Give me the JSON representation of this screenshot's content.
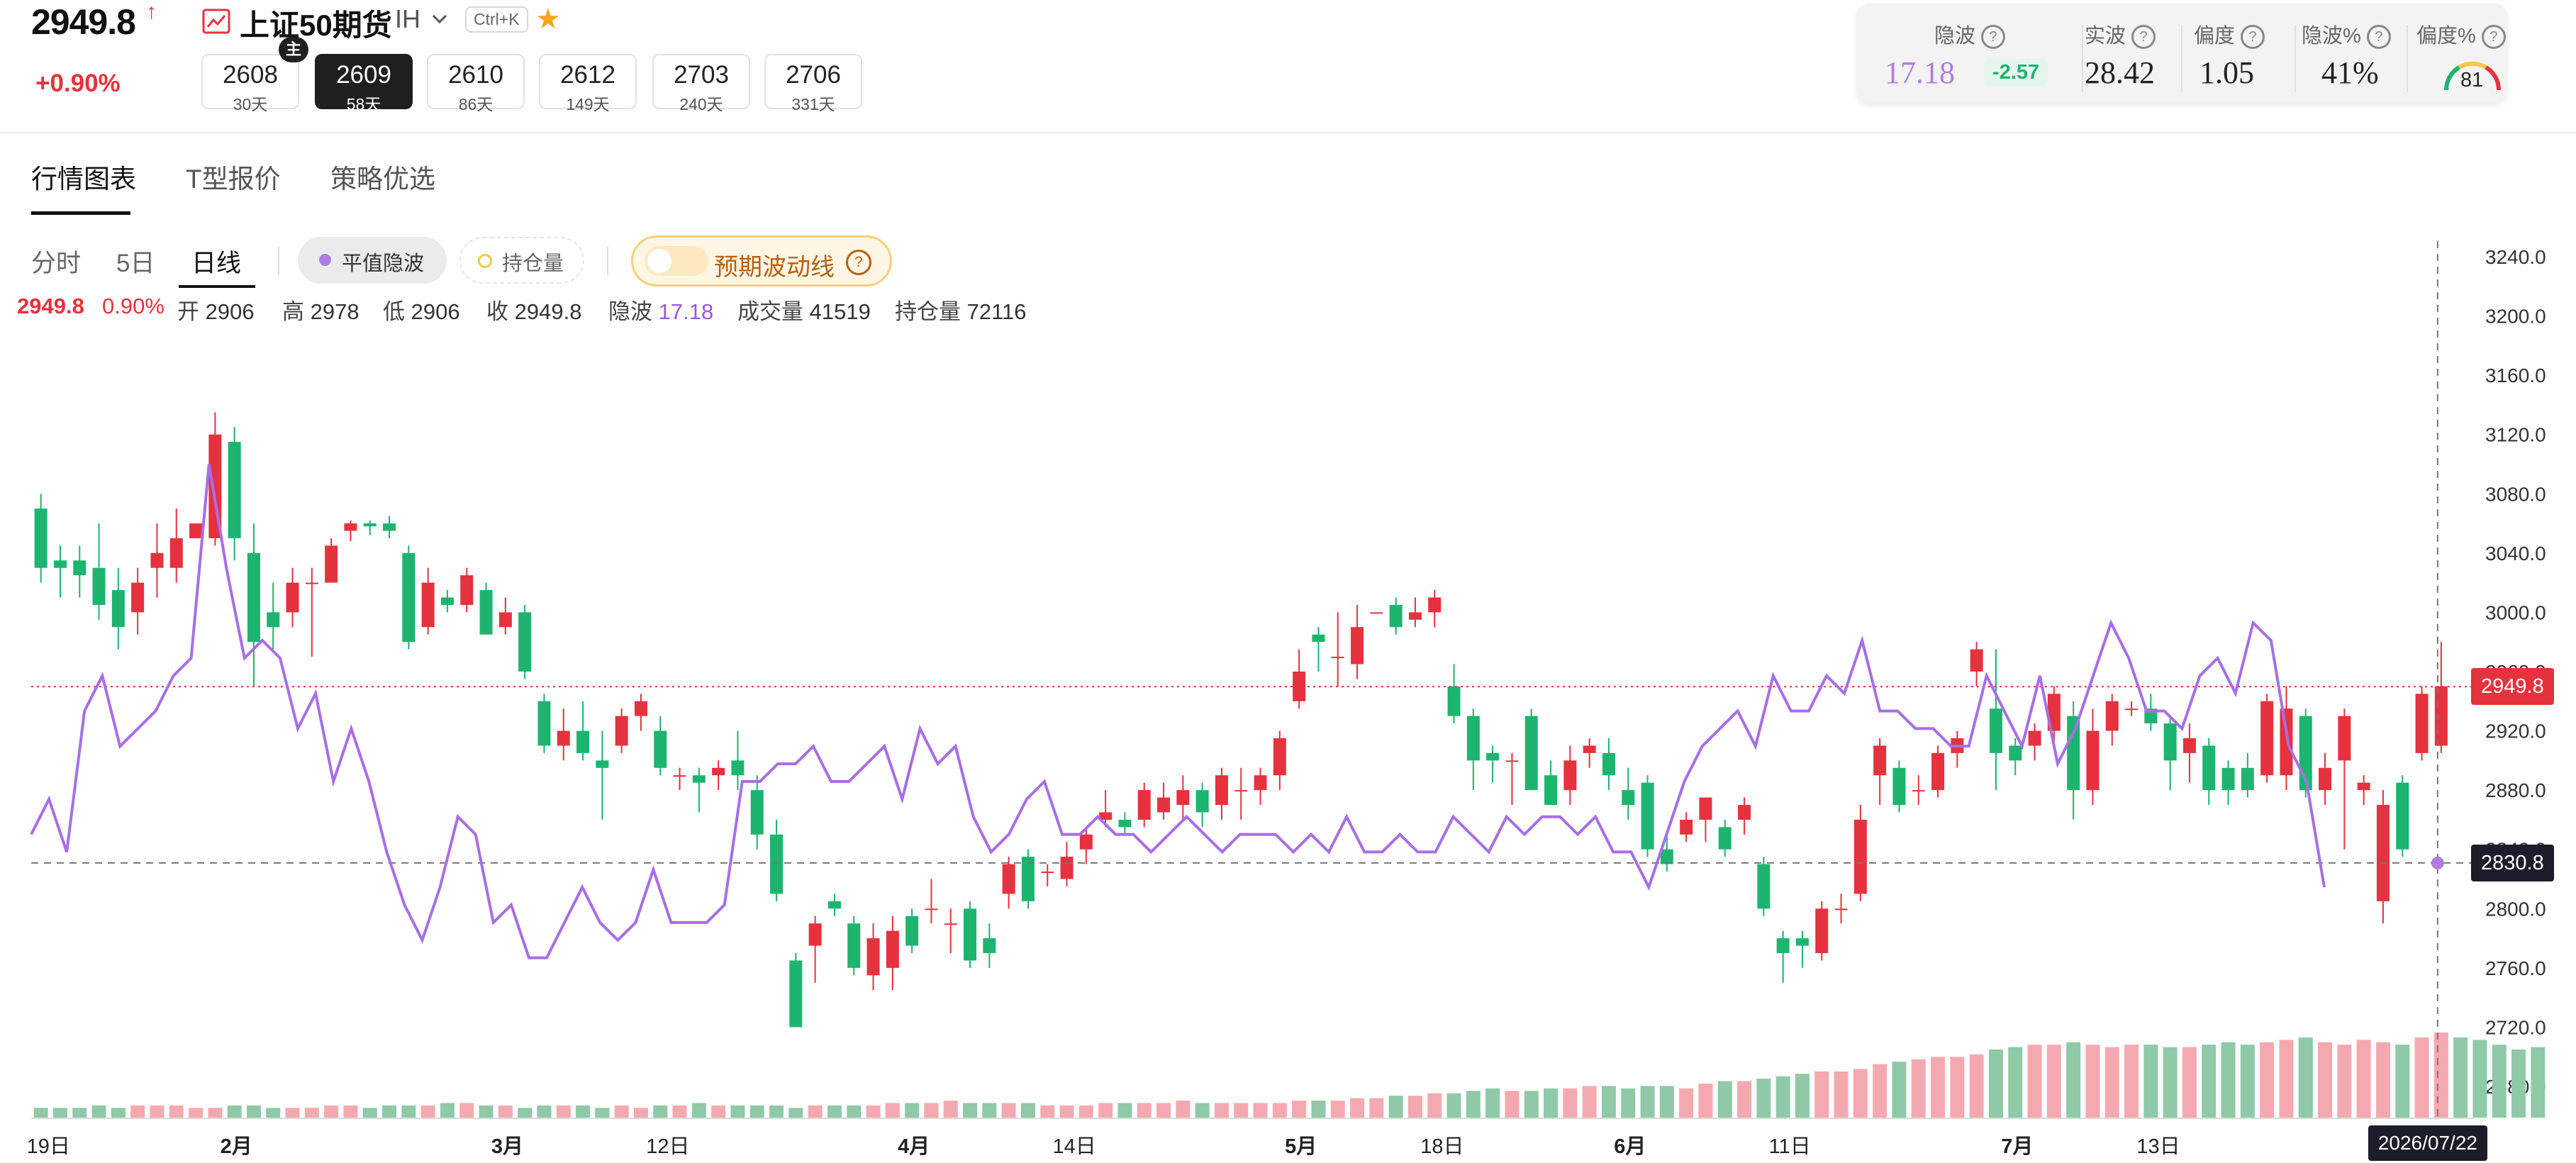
{
  "header": {
    "price": "2949.8",
    "price_arrow": "↑",
    "change_pct": "+0.90%",
    "title": "上证50期货",
    "code": "IH",
    "shortcut": "Ctrl+K",
    "main_badge": "主",
    "colors": {
      "up": "#e5323e",
      "down": "#1db470",
      "accent": "#f5a623"
    }
  },
  "contracts": [
    {
      "code": "2608",
      "days": "30天",
      "active": false
    },
    {
      "code": "2609",
      "days": "58天",
      "active": true
    },
    {
      "code": "2610",
      "days": "86天",
      "active": false
    },
    {
      "code": "2612",
      "days": "149天",
      "active": false
    },
    {
      "code": "2703",
      "days": "240天",
      "active": false
    },
    {
      "code": "2706",
      "days": "331天",
      "active": false
    }
  ],
  "stats": {
    "iv_label": "隐波",
    "iv_value": "17.18",
    "iv_change": "-2.57",
    "rv_label": "实波",
    "rv_value": "28.42",
    "skew_label": "偏度",
    "skew_value": "1.05",
    "iv_pct_label": "隐波%",
    "iv_pct_value": "41%",
    "skew_pct_label": "偏度%",
    "skew_pct_value": "81",
    "help_glyph": "?"
  },
  "main_tabs": [
    "行情图表",
    "T型报价",
    "策略优选"
  ],
  "period_tabs": [
    "分时",
    "5日",
    "日线"
  ],
  "toggles": {
    "flat_iv": "平值隐波",
    "open_interest": "持仓量",
    "expected_vol": "预期波动线",
    "help": "?"
  },
  "info": {
    "price": "2949.8",
    "pct": "0.90%",
    "open_label": "开",
    "open": "2906",
    "high_label": "高",
    "high": "2978",
    "low_label": "低",
    "low": "2906",
    "close_label": "收",
    "close": "2949.8",
    "iv_label": "隐波",
    "iv": "17.18",
    "vol_label": "成交量",
    "vol": "41519",
    "oi_label": "持仓量",
    "oi": "72116"
  },
  "chart_data": {
    "type": "candlestick",
    "y_axis": {
      "min": 2660,
      "max": 3260,
      "ticks": [
        "2680.0",
        "2720.0",
        "2760.0",
        "2800.0",
        "2840.0",
        "2880.0",
        "2920.0",
        "2960.0",
        "3000.0",
        "3040.0",
        "3080.0",
        "3120.0",
        "3160.0",
        "3200.0",
        "3240.0"
      ]
    },
    "x_labels": [
      {
        "i": 0,
        "t": "19日"
      },
      {
        "i": 10,
        "t": "2月"
      },
      {
        "i": 24,
        "t": "3月"
      },
      {
        "i": 32,
        "t": "12日"
      },
      {
        "i": 45,
        "t": "4月"
      },
      {
        "i": 53,
        "t": "14日"
      },
      {
        "i": 65,
        "t": "5月"
      },
      {
        "i": 72,
        "t": "18日"
      },
      {
        "i": 82,
        "t": "6月"
      },
      {
        "i": 90,
        "t": "11日"
      },
      {
        "i": 102,
        "t": "7月"
      },
      {
        "i": 109,
        "t": "13日"
      }
    ],
    "cursor_date": "2026/07/22",
    "current_price_label": "2949.8",
    "cursor_price_label": "2830.8",
    "current_price": 2949.8,
    "cursor_price": 2830.8,
    "candles": [
      [
        3070,
        3030,
        3080,
        3020
      ],
      [
        3035,
        3030,
        3045,
        3010
      ],
      [
        3035,
        3025,
        3045,
        3010
      ],
      [
        3030,
        3005,
        3060,
        2995
      ],
      [
        3015,
        2990,
        3030,
        2975
      ],
      [
        3000,
        3020,
        3030,
        2985
      ],
      [
        3030,
        3040,
        3060,
        3010
      ],
      [
        3030,
        3050,
        3070,
        3020
      ],
      [
        3050,
        3060,
        3060,
        3050
      ],
      [
        3050,
        3120,
        3135,
        3045
      ],
      [
        3115,
        3050,
        3125,
        3035
      ],
      [
        3040,
        2980,
        3060,
        2950
      ],
      [
        3000,
        2990,
        3020,
        2975
      ],
      [
        3000,
        3020,
        3030,
        2990
      ],
      [
        3020,
        3020,
        3030,
        2970
      ],
      [
        3020,
        3045,
        3050,
        3020
      ],
      [
        3055,
        3060,
        3062,
        3048
      ],
      [
        3060,
        3058,
        3062,
        3052
      ],
      [
        3060,
        3055,
        3065,
        3050
      ],
      [
        3040,
        2980,
        3045,
        2975
      ],
      [
        2990,
        3020,
        3030,
        2985
      ],
      [
        3010,
        3005,
        3015,
        3000
      ],
      [
        3005,
        3025,
        3030,
        3000
      ],
      [
        3015,
        2985,
        3020,
        2985
      ],
      [
        2990,
        3000,
        3010,
        2985
      ],
      [
        3000,
        2960,
        3005,
        2955
      ],
      [
        2940,
        2910,
        2945,
        2905
      ],
      [
        2910,
        2920,
        2935,
        2900
      ],
      [
        2920,
        2905,
        2940,
        2900
      ],
      [
        2900,
        2895,
        2920,
        2860
      ],
      [
        2910,
        2930,
        2935,
        2905
      ],
      [
        2930,
        2940,
        2945,
        2920
      ],
      [
        2920,
        2895,
        2930,
        2890
      ],
      [
        2890,
        2890,
        2895,
        2880
      ],
      [
        2890,
        2885,
        2895,
        2865
      ],
      [
        2890,
        2895,
        2900,
        2880
      ],
      [
        2900,
        2890,
        2920,
        2880
      ],
      [
        2880,
        2850,
        2890,
        2840
      ],
      [
        2850,
        2810,
        2860,
        2805
      ],
      [
        2765,
        2720,
        2770,
        2720
      ],
      [
        2775,
        2790,
        2795,
        2750
      ],
      [
        2805,
        2800,
        2810,
        2795
      ],
      [
        2790,
        2760,
        2795,
        2755
      ],
      [
        2755,
        2780,
        2790,
        2745
      ],
      [
        2760,
        2785,
        2795,
        2745
      ],
      [
        2795,
        2775,
        2800,
        2770
      ],
      [
        2800,
        2800,
        2820,
        2790
      ],
      [
        2790,
        2790,
        2800,
        2770
      ],
      [
        2800,
        2765,
        2805,
        2760
      ],
      [
        2780,
        2770,
        2790,
        2760
      ],
      [
        2810,
        2830,
        2835,
        2800
      ],
      [
        2835,
        2805,
        2840,
        2800
      ],
      [
        2825,
        2825,
        2830,
        2815
      ],
      [
        2820,
        2835,
        2845,
        2815
      ],
      [
        2840,
        2850,
        2855,
        2830
      ],
      [
        2860,
        2865,
        2880,
        2855
      ],
      [
        2860,
        2855,
        2865,
        2850
      ],
      [
        2860,
        2880,
        2885,
        2855
      ],
      [
        2865,
        2875,
        2885,
        2860
      ],
      [
        2870,
        2880,
        2890,
        2860
      ],
      [
        2880,
        2865,
        2885,
        2855
      ],
      [
        2870,
        2890,
        2895,
        2860
      ],
      [
        2880,
        2880,
        2895,
        2860
      ],
      [
        2880,
        2890,
        2895,
        2870
      ],
      [
        2890,
        2915,
        2920,
        2880
      ],
      [
        2940,
        2960,
        2975,
        2935
      ],
      [
        2985,
        2980,
        2990,
        2960
      ],
      [
        2970,
        2970,
        3000,
        2950
      ],
      [
        2965,
        2990,
        3005,
        2955
      ],
      [
        3000,
        3000,
        3000,
        3000
      ],
      [
        3005,
        2990,
        3010,
        2985
      ],
      [
        2995,
        3000,
        3010,
        2990
      ],
      [
        3000,
        3010,
        3015,
        2990
      ],
      [
        2950,
        2930,
        2965,
        2925
      ],
      [
        2930,
        2900,
        2935,
        2880
      ],
      [
        2905,
        2900,
        2910,
        2885
      ],
      [
        2900,
        2900,
        2905,
        2870
      ],
      [
        2930,
        2880,
        2935,
        2880
      ],
      [
        2890,
        2870,
        2900,
        2870
      ],
      [
        2880,
        2900,
        2910,
        2870
      ],
      [
        2905,
        2910,
        2915,
        2895
      ],
      [
        2905,
        2890,
        2915,
        2880
      ],
      [
        2880,
        2870,
        2895,
        2860
      ],
      [
        2885,
        2840,
        2890,
        2835
      ],
      [
        2840,
        2830,
        2850,
        2825
      ],
      [
        2850,
        2860,
        2865,
        2845
      ],
      [
        2860,
        2875,
        2870,
        2845
      ],
      [
        2855,
        2840,
        2860,
        2835
      ],
      [
        2860,
        2870,
        2875,
        2850
      ],
      [
        2830,
        2800,
        2835,
        2795
      ],
      [
        2780,
        2770,
        2785,
        2750
      ],
      [
        2780,
        2775,
        2785,
        2760
      ],
      [
        2770,
        2800,
        2805,
        2765
      ],
      [
        2800,
        2800,
        2810,
        2790
      ],
      [
        2810,
        2860,
        2870,
        2805
      ],
      [
        2890,
        2910,
        2915,
        2870
      ],
      [
        2895,
        2870,
        2900,
        2865
      ],
      [
        2880,
        2880,
        2890,
        2870
      ],
      [
        2880,
        2905,
        2910,
        2875
      ],
      [
        2905,
        2915,
        2920,
        2895
      ],
      [
        2960,
        2975,
        2980,
        2950
      ],
      [
        2935,
        2905,
        2975,
        2880
      ],
      [
        2910,
        2900,
        2915,
        2890
      ],
      [
        2910,
        2920,
        2925,
        2900
      ],
      [
        2920,
        2945,
        2950,
        2910
      ],
      [
        2930,
        2880,
        2940,
        2860
      ],
      [
        2880,
        2920,
        2935,
        2870
      ],
      [
        2920,
        2940,
        2945,
        2910
      ],
      [
        2935,
        2935,
        2940,
        2930
      ],
      [
        2935,
        2925,
        2945,
        2920
      ],
      [
        2925,
        2900,
        2930,
        2880
      ],
      [
        2905,
        2915,
        2925,
        2885
      ],
      [
        2910,
        2880,
        2915,
        2870
      ],
      [
        2895,
        2880,
        2900,
        2870
      ],
      [
        2895,
        2880,
        2905,
        2875
      ],
      [
        2890,
        2940,
        2945,
        2885
      ],
      [
        2890,
        2935,
        2950,
        2880
      ],
      [
        2930,
        2880,
        2935,
        2875
      ],
      [
        2880,
        2895,
        2905,
        2870
      ],
      [
        2900,
        2930,
        2935,
        2840
      ],
      [
        2880,
        2885,
        2890,
        2870
      ],
      [
        2805,
        2870,
        2880,
        2790
      ],
      [
        2885,
        2840,
        2890,
        2835
      ],
      [
        2905,
        2945,
        2950,
        2900
      ],
      [
        2910,
        2950,
        2980,
        2905
      ]
    ],
    "iv_line": [
      21,
      23,
      20,
      28,
      30,
      26,
      27,
      28,
      30,
      31,
      42,
      36,
      31,
      32,
      31,
      27,
      29,
      24,
      27,
      24,
      20,
      17,
      15,
      18,
      22,
      21,
      16,
      17,
      14,
      14,
      16,
      18,
      16,
      15,
      16,
      19,
      16,
      16,
      16,
      17,
      24,
      24,
      25,
      25,
      26,
      24,
      24,
      25,
      26,
      23,
      27,
      25,
      26,
      22,
      20,
      21,
      23,
      24,
      21,
      21,
      22,
      21,
      21,
      20,
      21,
      22,
      21,
      20,
      21,
      21,
      21,
      20,
      21,
      20,
      22,
      20,
      20,
      21,
      20,
      20,
      22,
      21,
      20,
      22,
      21,
      22,
      22,
      21,
      22,
      20,
      20,
      18,
      21,
      24,
      26,
      27,
      28,
      26,
      30,
      28,
      28,
      30,
      29,
      32,
      28,
      28,
      27,
      27,
      26,
      26,
      30,
      28,
      26,
      30,
      25,
      27,
      30,
      33,
      31,
      28,
      28,
      27,
      30,
      31,
      29,
      33,
      32,
      26,
      24,
      18
    ],
    "volume": [
      4,
      4,
      4,
      5,
      4,
      5,
      5,
      5,
      4,
      4,
      5,
      5,
      4,
      4,
      4,
      5,
      5,
      4,
      5,
      5,
      5,
      6,
      6,
      5,
      5,
      4,
      5,
      5,
      5,
      4,
      5,
      4,
      5,
      5,
      6,
      5,
      5,
      5,
      5,
      4,
      5,
      5,
      5,
      5,
      6,
      6,
      6,
      7,
      6,
      6,
      6,
      6,
      5,
      5,
      5,
      6,
      6,
      6,
      6,
      7,
      6,
      6,
      6,
      6,
      6,
      7,
      7,
      7,
      8,
      8,
      9,
      9,
      10,
      10,
      11,
      12,
      11,
      11,
      12,
      12,
      13,
      13,
      12,
      13,
      13,
      12,
      14,
      15,
      15,
      16,
      17,
      18,
      19,
      19,
      20,
      22,
      23,
      24,
      25,
      25,
      26,
      28,
      29,
      30,
      30,
      31,
      30,
      29,
      30,
      30,
      29,
      29,
      30,
      31,
      30,
      31,
      32,
      33,
      31,
      30,
      32,
      31,
      30,
      33,
      35,
      33,
      32,
      30,
      28,
      29
    ]
  }
}
